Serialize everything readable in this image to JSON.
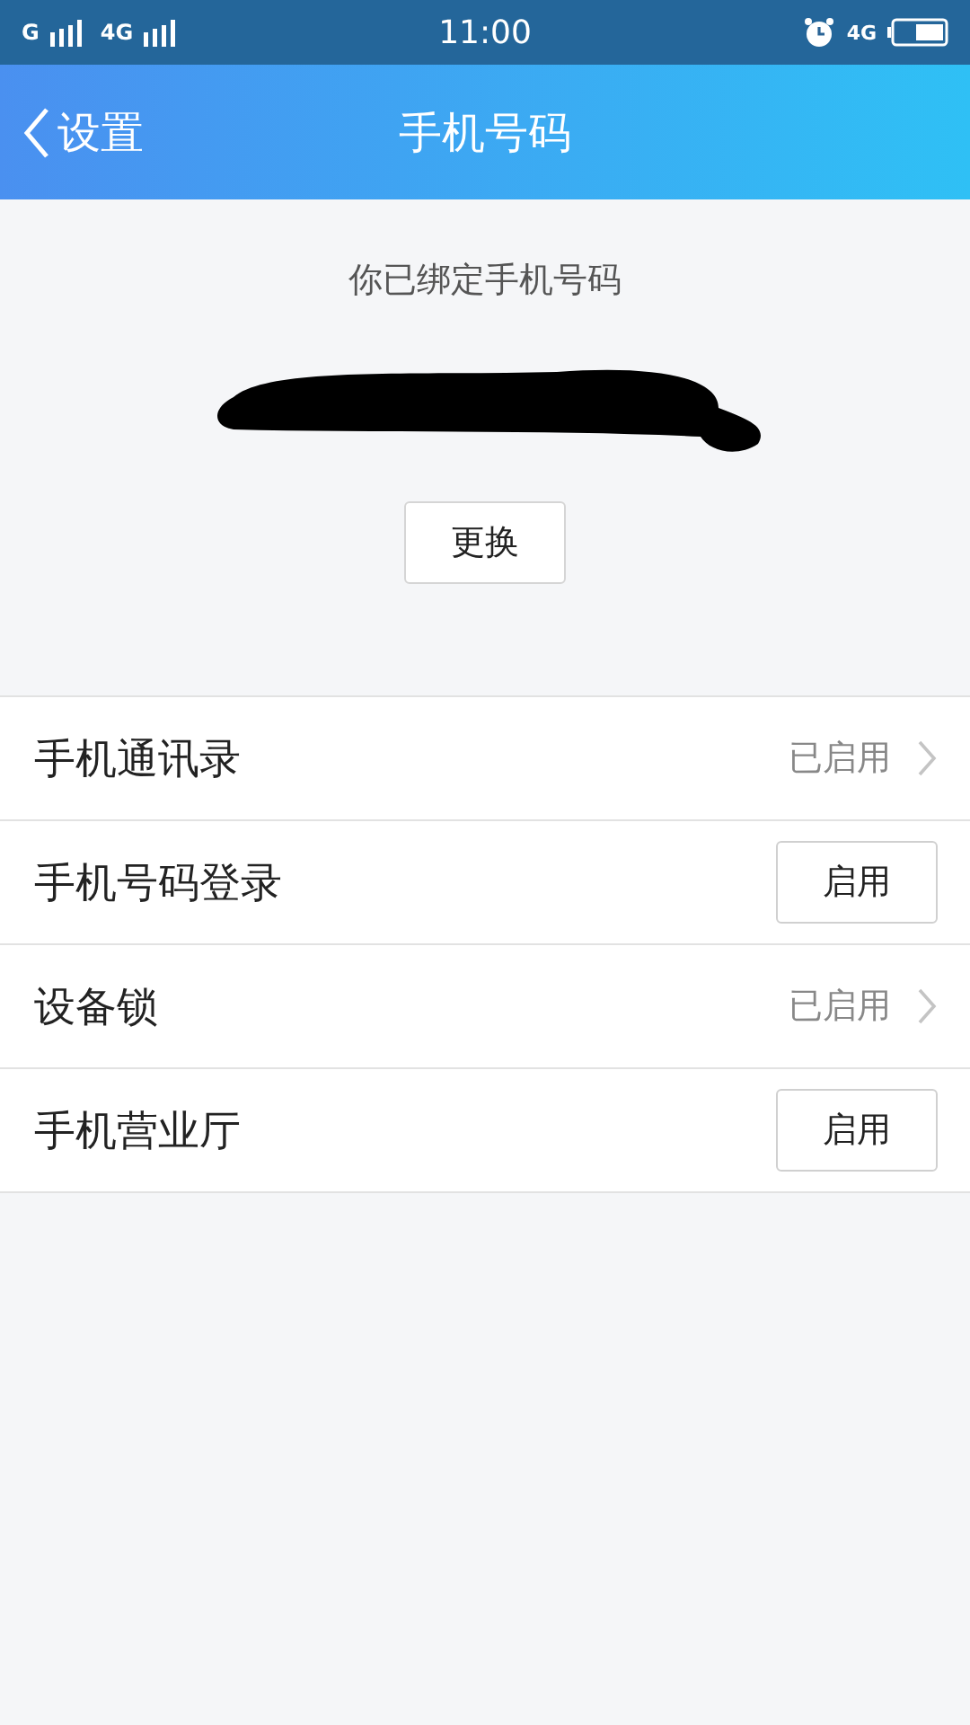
{
  "status_bar": {
    "carrier_1": "G",
    "carrier_2": "4G",
    "time": "11:00",
    "network": "4G"
  },
  "nav": {
    "back": "设置",
    "title": "手机号码"
  },
  "phone": {
    "caption": "你已绑定手机号码",
    "change_button": "更换"
  },
  "rows": [
    {
      "kind": "status",
      "label": "手机通讯录",
      "value": "已启用"
    },
    {
      "kind": "button",
      "label": "手机号码登录",
      "value": "启用"
    },
    {
      "kind": "status",
      "label": "设备锁",
      "value": "已启用"
    },
    {
      "kind": "button",
      "label": "手机营业厅",
      "value": "启用"
    }
  ]
}
